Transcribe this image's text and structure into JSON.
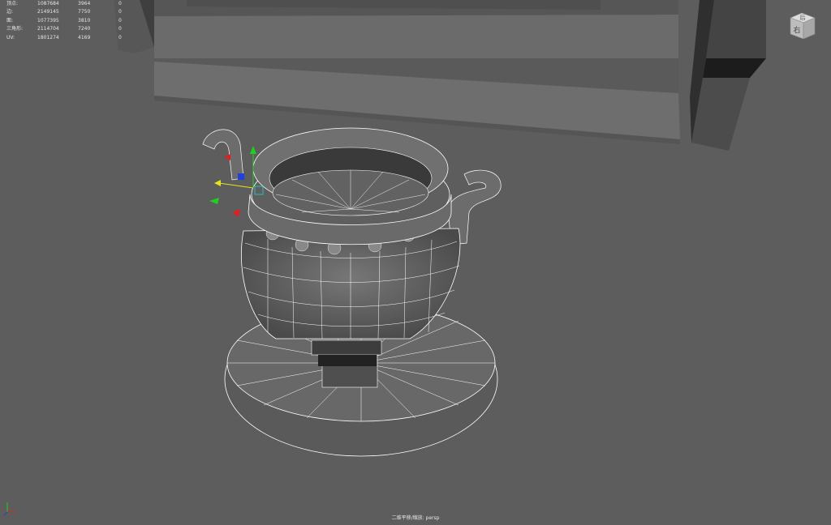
{
  "heads_up_display": {
    "rows": [
      {
        "label": "顶点:",
        "v1": "1087684",
        "v2": "3964",
        "v3": "0"
      },
      {
        "label": "边:",
        "v1": "2149145",
        "v2": "7750",
        "v3": "0"
      },
      {
        "label": "面:",
        "v1": "1077395",
        "v2": "3810",
        "v3": "0"
      },
      {
        "label": "三角形:",
        "v1": "2114704",
        "v2": "7240",
        "v3": "0"
      },
      {
        "label": "UV:",
        "v1": "1801274",
        "v2": "4169",
        "v3": "0"
      }
    ]
  },
  "view_cube": {
    "top_face": "后",
    "front_face": "右"
  },
  "camera_label": "二维平移/缩放: persp",
  "colors": {
    "viewport_bg": "#5d5d5d",
    "wireframe": "#ffffff",
    "axis_x": "#e02020",
    "axis_y": "#20d020",
    "axis_z": "#2040e0",
    "axis_free": "#e8e020"
  },
  "icons": [
    "view-cube-icon",
    "axis-tripod-icon",
    "move-manipulator-icon"
  ]
}
